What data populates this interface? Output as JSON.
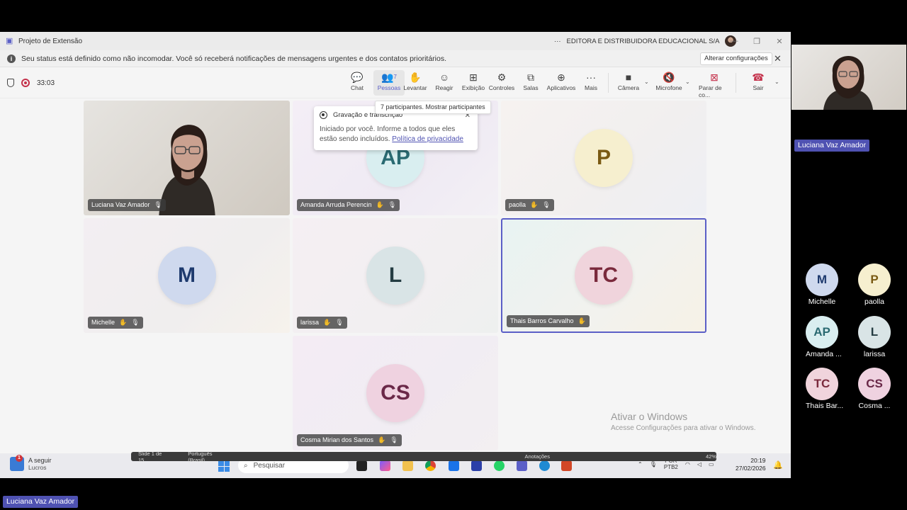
{
  "window": {
    "title": "Projeto de Extensão",
    "org": "EDITORA E DISTRIBUIDORA EDUCACIONAL S/A",
    "more": "···"
  },
  "banner": {
    "text": "Seu status está definido como não incomodar. Você só receberá notificações de mensagens urgentes e dos contatos prioritários.",
    "button": "Alterar configurações"
  },
  "toolbar": {
    "timer": "33:03",
    "people_count": "7",
    "buttons": {
      "chat": "Chat",
      "people": "Pessoas",
      "raise": "Levantar",
      "react": "Reagir",
      "view": "Exibição",
      "controls": "Controles",
      "rooms": "Salas",
      "apps": "Aplicativos",
      "more": "Mais",
      "camera": "Câmera",
      "mic": "Microfone",
      "share": "Parar de co...",
      "leave": "Sair"
    }
  },
  "tooltip": "7 participantes. Mostrar participantes",
  "recording_popup": {
    "title": "Gravação e transcrição",
    "body": "Iniciado por você. Informe a todos que eles estão sendo incluídos.",
    "link": "Política de privacidade"
  },
  "tiles": [
    {
      "name": "Luciana Vaz Amador"
    },
    {
      "name": "Amanda Arruda Perencin",
      "initials": "AP"
    },
    {
      "name": "paolla",
      "initials": "P"
    },
    {
      "name": "Michelle",
      "initials": "M"
    },
    {
      "name": "larissa",
      "initials": "L"
    },
    {
      "name": "Thais Barros Carvalho",
      "initials": "TC"
    },
    {
      "name": "Cosma Mirian dos Santos",
      "initials": "CS"
    }
  ],
  "watermark": {
    "line1": "Ativar o Windows",
    "line2": "Acesse Configurações para ativar o Windows."
  },
  "ppt_status": {
    "slide": "Slide 1 de 15",
    "lang": "Português (Brasil)",
    "notes": "Anotações",
    "zoom": "42%"
  },
  "taskbar": {
    "news_title": "A seguir",
    "news_sub": "Lucros",
    "news_badge": "1",
    "search": "Pesquisar",
    "ime_top": "POR",
    "ime_bottom": "PTB2",
    "time": "20:19",
    "date": "27/02/2026"
  },
  "right_panel": {
    "self_name": "Luciana Vaz Amador",
    "bottom_name": "Luciana Vaz Amador",
    "participants": [
      {
        "initials": "M",
        "name": "Michelle"
      },
      {
        "initials": "P",
        "name": "paolla"
      },
      {
        "initials": "AP",
        "name": "Amanda ..."
      },
      {
        "initials": "L",
        "name": "larissa"
      },
      {
        "initials": "TC",
        "name": "Thais Bar..."
      },
      {
        "initials": "CS",
        "name": "Cosma ..."
      }
    ]
  }
}
